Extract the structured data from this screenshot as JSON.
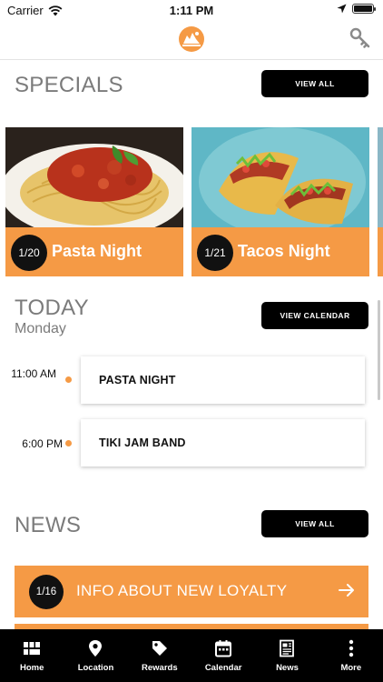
{
  "status_bar": {
    "carrier": "Carrier",
    "time": "1:11 PM"
  },
  "specials": {
    "title": "SPECIALS",
    "view_all": "VIEW ALL",
    "cards": [
      {
        "date": "1/20",
        "title": "Pasta Night"
      },
      {
        "date": "1/21",
        "title": "Tacos Night"
      }
    ]
  },
  "today": {
    "title": "TODAY",
    "day": "Monday",
    "view_calendar": "VIEW CALENDAR",
    "events": [
      {
        "time": "11:00 AM",
        "name": "PASTA NIGHT"
      },
      {
        "time": "6:00 PM",
        "name": "TIKI JAM BAND"
      }
    ]
  },
  "news": {
    "title": "NEWS",
    "view_all": "VIEW ALL",
    "items": [
      {
        "date": "1/16",
        "title": "INFO ABOUT NEW LOYALTY"
      }
    ]
  },
  "tabs": [
    {
      "label": "Home",
      "icon": "home-grid-icon"
    },
    {
      "label": "Location",
      "icon": "map-pin-icon"
    },
    {
      "label": "Rewards",
      "icon": "tag-icon"
    },
    {
      "label": "Calendar",
      "icon": "calendar-icon"
    },
    {
      "label": "News",
      "icon": "newspaper-icon"
    },
    {
      "label": "More",
      "icon": "more-vertical-icon"
    }
  ],
  "colors": {
    "accent": "#f59a45",
    "dark": "#000000",
    "muted_text": "#7b7b7b"
  }
}
